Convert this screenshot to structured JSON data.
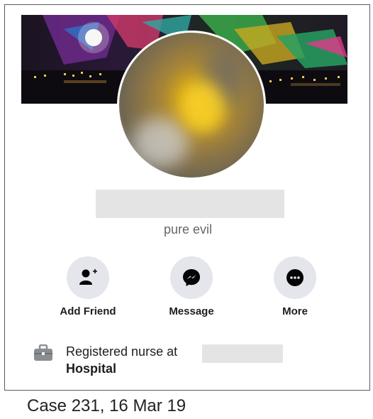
{
  "profile": {
    "bio": "pure evil",
    "actions": [
      {
        "label": "Add Friend",
        "icon": "add-friend-icon"
      },
      {
        "label": "Message",
        "icon": "messenger-icon"
      },
      {
        "label": "More",
        "icon": "more-icon"
      }
    ],
    "work": {
      "line1": "Registered nurse at",
      "line2": "Hospital",
      "icon": "briefcase-icon"
    }
  },
  "caption": "Case 231, 16 Mar 19",
  "colors": {
    "button_bg": "#e4e6eb",
    "text_primary": "#1c1e21",
    "text_secondary": "#65676b",
    "redaction": "#e4e4e4"
  }
}
